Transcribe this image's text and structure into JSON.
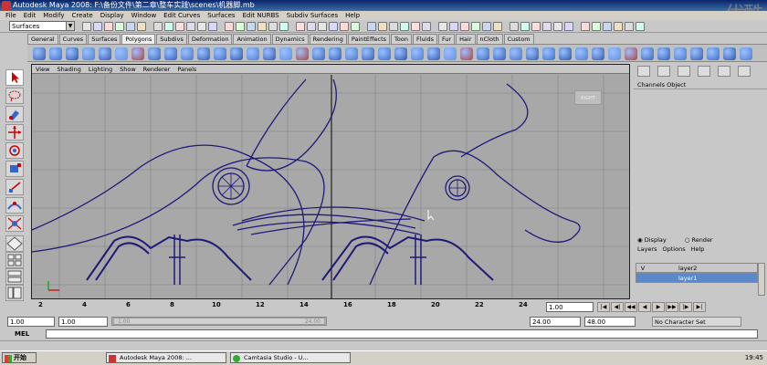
{
  "window": {
    "title": "Autodesk Maya 2008: F:\\备份文件\\第二章\\整车实践\\scenes\\机器脚.mb"
  },
  "watermark": "优酷",
  "menus": [
    "File",
    "Edit",
    "Modify",
    "Create",
    "Display",
    "Window",
    "Edit Curves",
    "Surfaces",
    "Edit NURBS",
    "Subdiv Surfaces",
    "Help"
  ],
  "status": {
    "mode": "Surfaces"
  },
  "shelf_tabs": [
    "General",
    "Curves",
    "Surfaces",
    "Polygons",
    "Subdivs",
    "Deformation",
    "Animation",
    "Dynamics",
    "Rendering",
    "PaintEffects",
    "Toon",
    "Fluids",
    "Fur",
    "Hair",
    "nCloth",
    "Custom"
  ],
  "active_shelf_tab": "Polygons",
  "viewport": {
    "menu": [
      "View",
      "Shading",
      "Lighting",
      "Show",
      "Renderer",
      "Panels"
    ],
    "view_cube_label": "RIGHT",
    "wire_color": "#1d1a78"
  },
  "channel_box": {
    "header": "Channels  Object"
  },
  "layers": {
    "display_label": "Display",
    "render_label": "Render",
    "menu": [
      "Layers",
      "Options",
      "Help"
    ],
    "items": [
      {
        "v": "V",
        "name": "layer2",
        "selected": false
      },
      {
        "v": "",
        "name": "layer1",
        "selected": true
      }
    ]
  },
  "timeline": {
    "ticks": [
      "2",
      "4",
      "6",
      "8",
      "10",
      "12",
      "14",
      "16",
      "18",
      "20",
      "22",
      "24"
    ],
    "current_frame": "1.00"
  },
  "range": {
    "start_time": "1.00",
    "start_playback": "1.00",
    "thumb_start": "1.00",
    "thumb_end": "24.00",
    "end_playback": "24.00",
    "end_time": "48.00",
    "character_set": "No Character Set"
  },
  "command": {
    "label": "MEL"
  },
  "taskbar": {
    "start": "开始",
    "tasks": [
      "Autodesk Maya 2008: ...",
      "Camtasia Studio - U..."
    ],
    "clock": "19:45"
  }
}
